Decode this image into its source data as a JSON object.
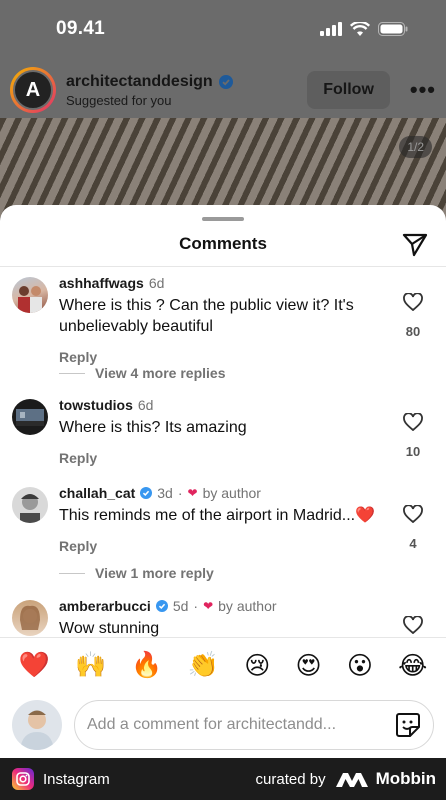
{
  "status_bar": {
    "time": "09.41"
  },
  "post": {
    "username": "architectanddesign",
    "subtitle": "Suggested for you",
    "follow_label": "Follow",
    "more_label": "•••",
    "image_counter": "1/2"
  },
  "sheet": {
    "title": "Comments"
  },
  "comments": [
    {
      "username": "ashhaffwags",
      "time": "6d",
      "text": "Where is this ? Can the public view it? It's unbelievably beautiful",
      "reply_label": "Reply",
      "likes": "80",
      "more_replies": "View 4 more replies"
    },
    {
      "username": "towstudios",
      "time": "6d",
      "text": "Where is this? Its amazing",
      "reply_label": "Reply",
      "likes": "10"
    },
    {
      "username": "challah_cat",
      "time": "3d",
      "by_author": "by author",
      "text": "This reminds me of the airport in Madrid...❤️",
      "reply_label": "Reply",
      "likes": "4",
      "more_replies": "View 1 more reply"
    },
    {
      "username": "amberarbucci",
      "time": "5d",
      "by_author": "by author",
      "text": "Wow stunning"
    }
  ],
  "emoji_bar": [
    "❤️",
    "🙌",
    "🔥",
    "👏",
    "😢",
    "😍",
    "😮",
    "😂"
  ],
  "comment_input": {
    "placeholder": "Add a comment for architectandd..."
  },
  "footer": {
    "app_name": "Instagram",
    "curated_by": "curated by",
    "brand": "Mobbin"
  },
  "colors": {
    "like_red": "#e0245e",
    "verified_blue": "#3897f0"
  }
}
